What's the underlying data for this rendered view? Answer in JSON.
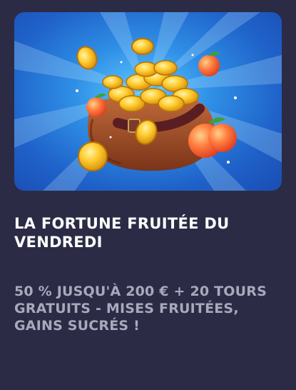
{
  "promotion": {
    "title": "LA FORTUNE FRUITÉE DU VENDREDI",
    "description": "50 % JUSQU'À 200 € + 20 TOURS GRATUITS - MISES FRUITÉES, GAINS SUCRÉS !",
    "image_icon": "coin-bag-with-peaches-icon"
  },
  "colors": {
    "card_background": "#2b2b45",
    "title_text": "#ffffff",
    "description_text": "#a9a9bd",
    "banner_blue": "#2f8fe6"
  }
}
